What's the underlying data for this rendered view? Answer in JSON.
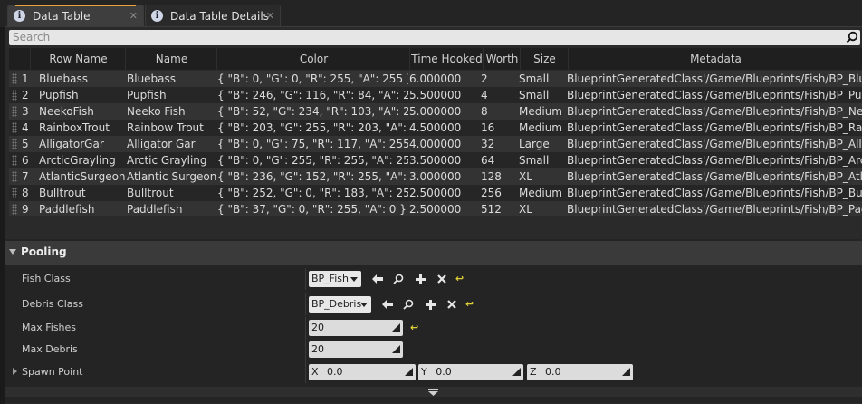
{
  "tabs": [
    {
      "label": "Data Table",
      "icon": "info-icon",
      "active": true
    },
    {
      "label": "Data Table Details",
      "icon": "info-icon",
      "active": false
    }
  ],
  "search": {
    "placeholder": "Search"
  },
  "table": {
    "columns": [
      "Row Name",
      "Name",
      "Color",
      "Time Hooked",
      "Worth",
      "Size",
      "Metadata"
    ],
    "rows": [
      {
        "num": "1",
        "row_name": "Bluebass",
        "name": "Bluebass",
        "color": "{ \"B\": 0, \"G\": 0, \"R\": 255, \"A\": 255 }",
        "time_hooked": "6.000000",
        "worth": "2",
        "size": "Small",
        "metadata": "BlueprintGeneratedClass'/Game/Blueprints/Fish/BP_Bluebass.BP_Bluebass_C'"
      },
      {
        "num": "2",
        "row_name": "Pupfish",
        "name": "Pupfish",
        "color": "{ \"B\": 246, \"G\": 116, \"R\": 84, \"A\": 255 }",
        "time_hooked": "5.500000",
        "worth": "4",
        "size": "Small",
        "metadata": "BlueprintGeneratedClass'/Game/Blueprints/Fish/BP_Pupfish.BP_Pupfish_C'"
      },
      {
        "num": "3",
        "row_name": "NeekoFish",
        "name": "Neeko Fish",
        "color": "{ \"B\": 52, \"G\": 234, \"R\": 103, \"A\": 255 }",
        "time_hooked": "5.000000",
        "worth": "8",
        "size": "Medium",
        "metadata": "BlueprintGeneratedClass'/Game/Blueprints/Fish/BP_NeekoFish.BP_NeekoFish_C'"
      },
      {
        "num": "4",
        "row_name": "RainboxTrout",
        "name": "Rainbow Trout",
        "color": "{ \"B\": 203, \"G\": 255, \"R\": 203, \"A\": 255 }",
        "time_hooked": "4.500000",
        "worth": "16",
        "size": "Medium",
        "metadata": "BlueprintGeneratedClass'/Game/Blueprints/Fish/BP_RainbowTrout.BP_RainbowTrout_C'"
      },
      {
        "num": "5",
        "row_name": "AlligatorGar",
        "name": "Alligator Gar",
        "color": "{ \"B\": 0, \"G\": 75, \"R\": 117, \"A\": 255 }",
        "time_hooked": "4.000000",
        "worth": "32",
        "size": "Large",
        "metadata": "BlueprintGeneratedClass'/Game/Blueprints/Fish/BP_AlligatorGar.BP_AlligatorGar_C'"
      },
      {
        "num": "6",
        "row_name": "ArcticGrayling",
        "name": "Arctic Grayling",
        "color": "{ \"B\": 0, \"G\": 255, \"R\": 255, \"A\": 255 }",
        "time_hooked": "3.500000",
        "worth": "64",
        "size": "Small",
        "metadata": "BlueprintGeneratedClass'/Game/Blueprints/Fish/BP_ArcticGrayling.BP_ArcticGrayling_C'"
      },
      {
        "num": "7",
        "row_name": "AtlanticSurgeon",
        "name": "Atlantic Surgeon",
        "color": "{ \"B\": 236, \"G\": 152, \"R\": 255, \"A\": 255 }",
        "time_hooked": "3.000000",
        "worth": "128",
        "size": "XL",
        "metadata": "BlueprintGeneratedClass'/Game/Blueprints/Fish/BP_AtlanticSurgeon.BP_AtlanticSurgeon_C'"
      },
      {
        "num": "8",
        "row_name": "Bulltrout",
        "name": "Bulltrout",
        "color": "{ \"B\": 252, \"G\": 0, \"R\": 183, \"A\": 255 }",
        "time_hooked": "2.500000",
        "worth": "256",
        "size": "Medium",
        "metadata": "BlueprintGeneratedClass'/Game/Blueprints/Fish/BP_Bulltrout.BP_Bulltrout_C'"
      },
      {
        "num": "9",
        "row_name": "Paddlefish",
        "name": "Paddlefish",
        "color": "{ \"B\": 37, \"G\": 0, \"R\": 255, \"A\": 0 }",
        "time_hooked": "2.500000",
        "worth": "512",
        "size": "XL",
        "metadata": "BlueprintGeneratedClass'/Game/Blueprints/Fish/BP_Paddlefish.BP_Paddlefish_C'"
      }
    ]
  },
  "details": {
    "category": "Pooling",
    "fish_class": {
      "label": "Fish Class",
      "value": "BP_Fish"
    },
    "debris_class": {
      "label": "Debris Class",
      "value": "BP_Debris"
    },
    "max_fishes": {
      "label": "Max Fishes",
      "value": "20"
    },
    "max_debris": {
      "label": "Max Debris",
      "value": "20"
    },
    "spawn_point": {
      "label": "Spawn Point",
      "x_label": "X",
      "x": "0.0",
      "y_label": "Y",
      "y": "0.0",
      "z_label": "Z",
      "z": "0.0"
    }
  },
  "colors": {
    "accent": "#e8a43a",
    "reset_arrow": "#e0cf35",
    "row_even": "#333333",
    "row_odd": "#262626"
  }
}
